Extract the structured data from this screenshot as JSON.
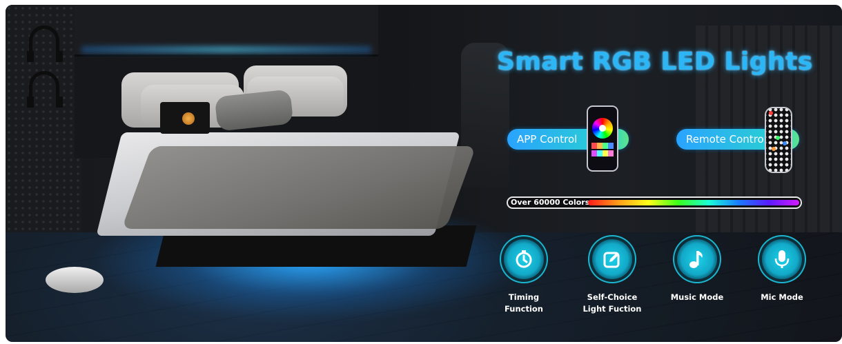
{
  "title": "Smart RGB LED Lights",
  "controls": {
    "app": "APP Control",
    "remote": "Remote Control"
  },
  "colors_bar": {
    "label": "Over 60000 Colors"
  },
  "features": [
    {
      "line1": "Timing",
      "line2": "Function",
      "icon": "timer-icon"
    },
    {
      "line1": "Self-Choice",
      "line2": "Light Fuction",
      "icon": "edit-icon"
    },
    {
      "line1": "Music Mode",
      "line2": "",
      "icon": "music-note-icon"
    },
    {
      "line1": "Mic Mode",
      "line2": "",
      "icon": "microphone-icon"
    }
  ],
  "accent_colors": {
    "title": "#2db6f5",
    "pill_start": "#2aa3ff",
    "pill_end": "#5fe38a",
    "feature_circle": "#1ed0e8"
  }
}
